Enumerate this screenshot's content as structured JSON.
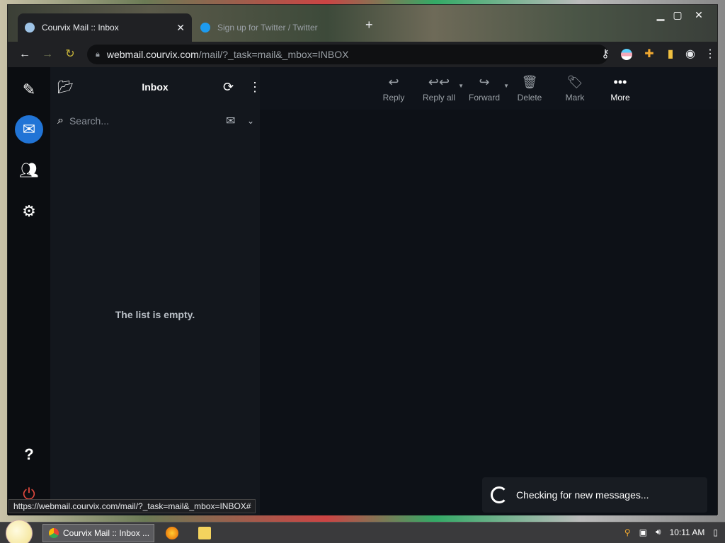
{
  "browser": {
    "tabs": [
      {
        "title": "Courvix Mail :: Inbox",
        "active": true
      },
      {
        "title": "Sign up for Twitter / Twitter",
        "active": false
      }
    ],
    "url_host": "webmail.courvix.com",
    "url_path": "/mail/?_task=mail&_mbox=INBOX",
    "status_url": "https://webmail.courvix.com/mail/?_task=mail&_mbox=INBOX#"
  },
  "mail": {
    "folder_title": "Inbox",
    "search_placeholder": "Search...",
    "empty_text": "The list is empty.",
    "toolbar": [
      {
        "label": "Reply",
        "icon": "reply-icon",
        "enabled": false
      },
      {
        "label": "Reply all",
        "icon": "reply-all-icon",
        "enabled": false
      },
      {
        "label": "Forward",
        "icon": "forward-icon",
        "enabled": false
      },
      {
        "label": "Delete",
        "icon": "trash-icon",
        "enabled": false
      },
      {
        "label": "Mark",
        "icon": "tag-icon",
        "enabled": false
      },
      {
        "label": "More",
        "icon": "more-icon",
        "enabled": true
      }
    ],
    "toast": "Checking for new messages..."
  },
  "taskbar": {
    "task_label": "Courvix Mail :: Inbox ...",
    "clock": "10:11 AM"
  },
  "colors": {
    "accent": "#2174d6"
  }
}
